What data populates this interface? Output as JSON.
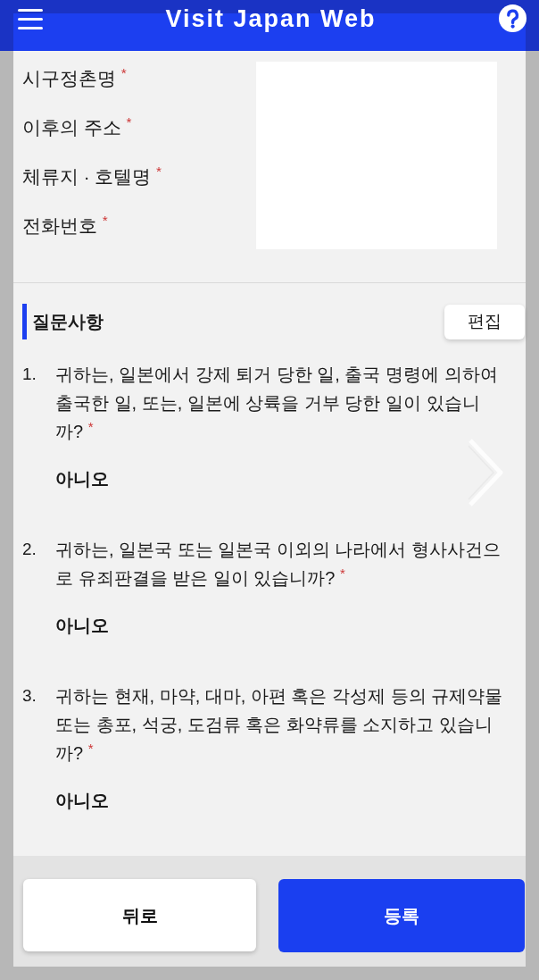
{
  "header": {
    "title": "Visit Japan Web"
  },
  "fields": [
    {
      "label": "시구정촌명 $^{*}$"
    },
    {
      "label": "이후의 주소 $^{*}$"
    },
    {
      "label": "체류지 · 호텔명 $^{*}$"
    },
    {
      "label": "전화번호 $^{*}$"
    }
  ],
  "questions_section": {
    "heading": "질문사항",
    "edit_button": "편집",
    "questions": [
      {
        "number": "1.",
        "text": "귀하는, 일본에서 강제 퇴거 당한 일, 출국 명령에 의하여 출국한 일, 또는, 일본에 상륙을 거부 당한 일이 있습니까? $^{*}$",
        "answer": "아니오"
      },
      {
        "number": "2.",
        "text": "귀하는, 일본국 또는 일본국 이외의 나라에서 형사사건으로 유죄판결을 받은 일이 있습니까? $^{*}$",
        "answer": "아니오"
      },
      {
        "number": "3.",
        "text": "귀하는 현재, 마약, 대마, 아편 혹은 각성제 등의 규제약물 또는 총포, 석궁, 도검류 혹은 화약류를 소지하고 있습니까? $^{*}$",
        "answer": "아니오"
      }
    ]
  },
  "footer": {
    "buttons": [
      {
        "label": "뒤로",
        "kind": "secondary"
      },
      {
        "label": "등록",
        "kind": "primary"
      }
    ]
  }
}
